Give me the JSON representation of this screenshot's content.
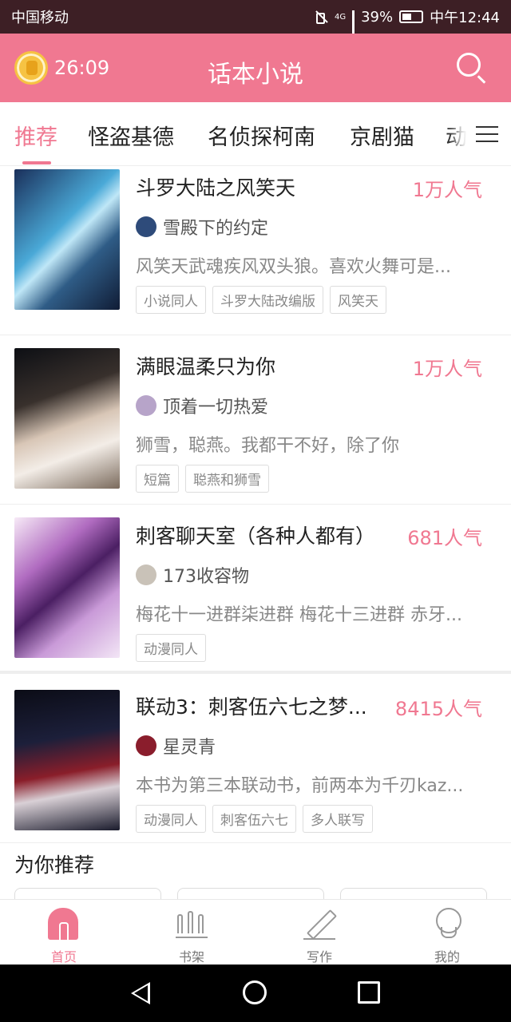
{
  "status": {
    "carrier": "中国移动",
    "network": "4G",
    "battery": "39%",
    "time": "中午12:44"
  },
  "header": {
    "timer": "26:09",
    "title": "话本小说"
  },
  "tabs": [
    "推荐",
    "怪盗基德",
    "名侦探柯南",
    "京剧猫",
    "动漫"
  ],
  "books": [
    {
      "title": "斗罗大陆之风笑天",
      "popularity": "1万人气",
      "author": "雪殿下的约定",
      "desc": "风笑天武魂疾风双头狼。喜欢火舞可是...",
      "tags": [
        "小说同人",
        "斗罗大陆改编版",
        "风笑天"
      ]
    },
    {
      "title": "满眼温柔只为你",
      "popularity": "1万人气",
      "author": "顶着一切热爱",
      "desc": "狮雪，聪燕。我都干不好，除了你",
      "tags": [
        "短篇",
        "聪燕和狮雪"
      ]
    },
    {
      "title": "刺客聊天室（各种人都有）",
      "popularity": "681人气",
      "author": "173收容物",
      "desc": "梅花十一进群柒进群 梅花十三进群 赤牙...",
      "tags": [
        "动漫同人"
      ]
    },
    {
      "title": "联动3：刺客伍六七之梦...",
      "popularity": "8415人气",
      "author": "星灵青",
      "desc": "本书为第三本联动书，前两本为千刃kaz...",
      "tags": [
        "动漫同人",
        "刺客伍六七",
        "多人联写"
      ]
    }
  ],
  "recommend": {
    "title": "为你推荐"
  },
  "bottom_nav": [
    "首页",
    "书架",
    "写作",
    "我的"
  ],
  "colors": {
    "accent": "#f07891",
    "status_bar": "#3d1f25"
  }
}
